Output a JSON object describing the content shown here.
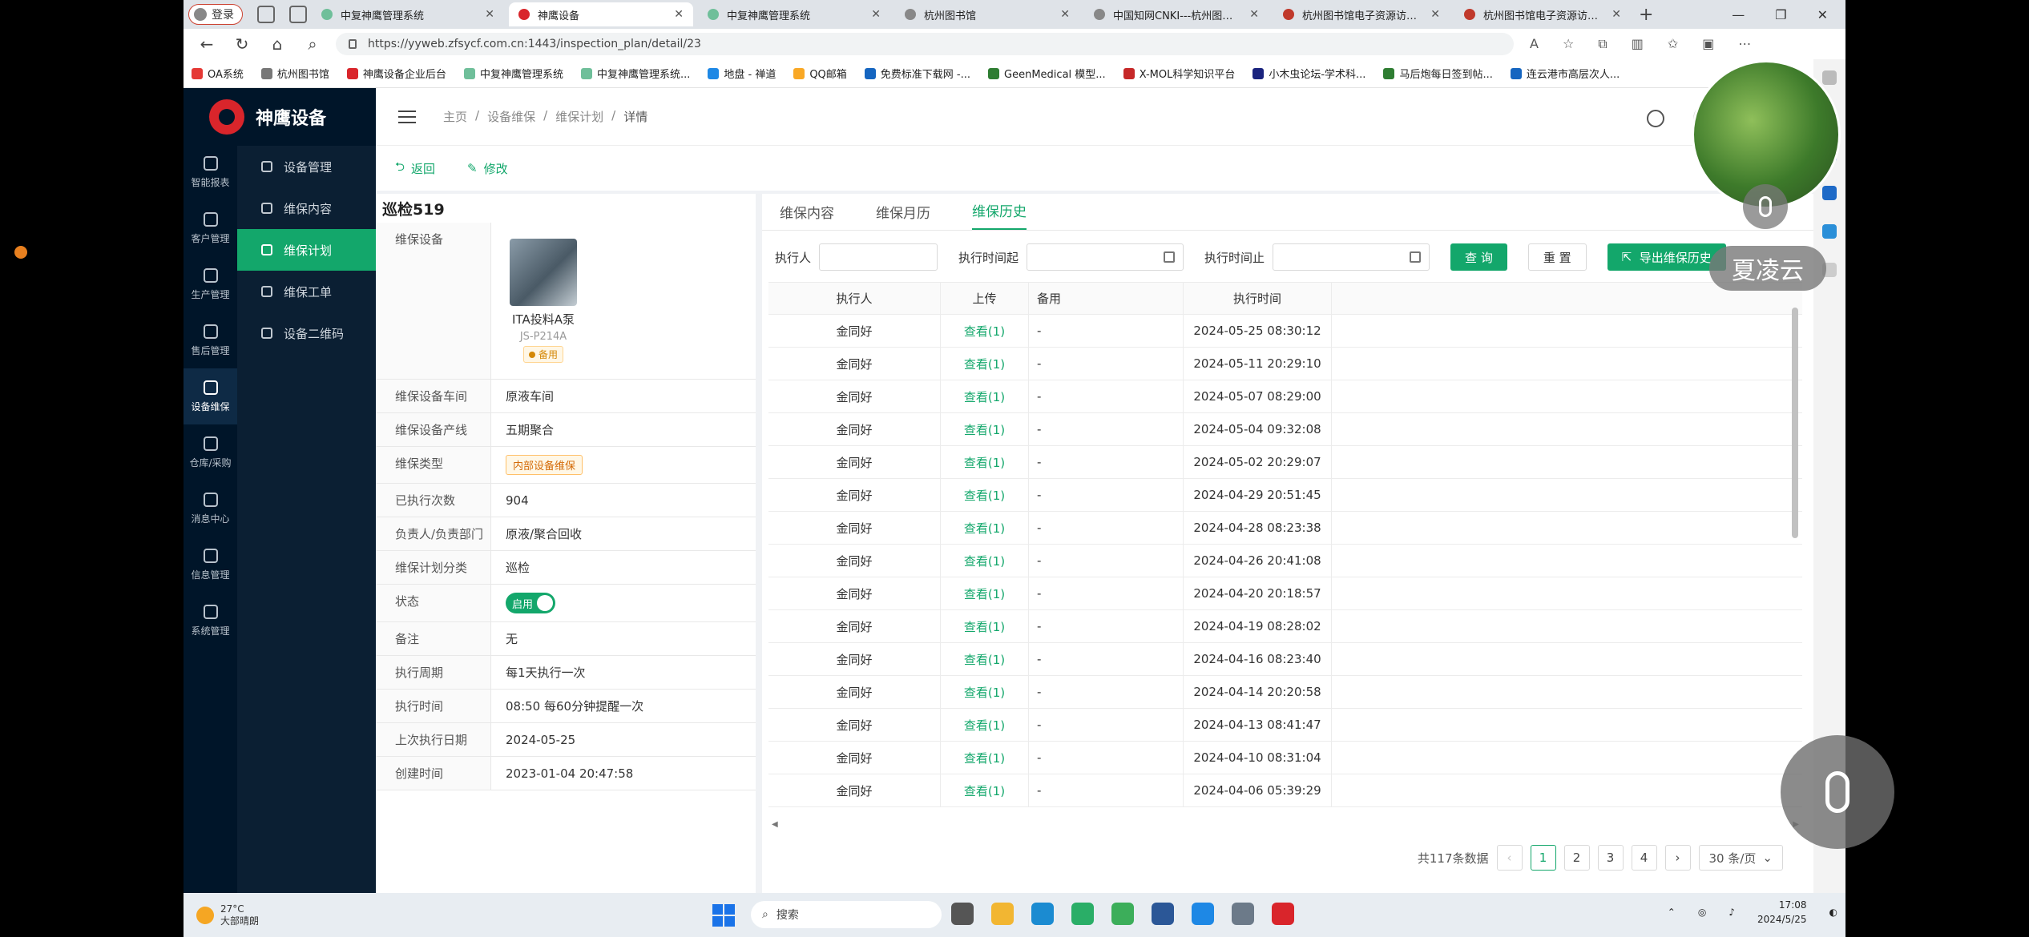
{
  "browser": {
    "login_label": "登录",
    "tabs": [
      {
        "title": "中复神鹰管理系统",
        "color": "#6fbf9a",
        "active": false
      },
      {
        "title": "神鹰设备",
        "color": "#d9252b",
        "active": true
      },
      {
        "title": "中复神鹰管理系统",
        "color": "#6fbf9a",
        "active": false
      },
      {
        "title": "杭州图书馆",
        "color": "#888888",
        "active": false
      },
      {
        "title": "中国知网CNKI---杭州图书馆",
        "color": "#888888",
        "active": false
      },
      {
        "title": "杭州图书馆电子资源访问系统",
        "color": "#c0392b",
        "active": false
      },
      {
        "title": "杭州图书馆电子资源访问系统",
        "color": "#c0392b",
        "active": false
      }
    ],
    "url": "https://yyweb.zfsycf.com.cn:1443/inspection_plan/detail/23",
    "bookmarks": [
      {
        "label": "OA系统",
        "color": "#e53935"
      },
      {
        "label": "杭州图书馆",
        "color": "#777777"
      },
      {
        "label": "神鹰设备企业后台",
        "color": "#d9252b"
      },
      {
        "label": "中复神鹰管理系统",
        "color": "#6fbf9a"
      },
      {
        "label": "中复神鹰管理系统...",
        "color": "#6fbf9a"
      },
      {
        "label": "地盘 - 禅道",
        "color": "#1e88e5"
      },
      {
        "label": "QQ邮箱",
        "color": "#f9a825"
      },
      {
        "label": "免费标准下载网 -...",
        "color": "#1565c0"
      },
      {
        "label": "GeenMedical 模型...",
        "color": "#2e7d32"
      },
      {
        "label": "X-MOL科学知识平台",
        "color": "#c62828"
      },
      {
        "label": "小木虫论坛-学术科...",
        "color": "#1a237e"
      },
      {
        "label": "马后炮每日签到帖...",
        "color": "#2e7d32"
      },
      {
        "label": "连云港市高层次人...",
        "color": "#1565c0"
      }
    ]
  },
  "app": {
    "name": "神鹰设备",
    "rail": [
      {
        "label": "智能报表",
        "active": false
      },
      {
        "label": "客户管理",
        "active": false
      },
      {
        "label": "生产管理",
        "active": false
      },
      {
        "label": "售后管理",
        "active": false
      },
      {
        "label": "设备维保",
        "active": true
      },
      {
        "label": "仓库/采购",
        "active": false
      },
      {
        "label": "消息中心",
        "active": false
      },
      {
        "label": "信息管理",
        "active": false
      },
      {
        "label": "系统管理",
        "active": false
      }
    ],
    "submenu": [
      {
        "label": "设备管理",
        "active": false
      },
      {
        "label": "维保内容",
        "active": false
      },
      {
        "label": "维保计划",
        "active": true
      },
      {
        "label": "维保工单",
        "active": false
      },
      {
        "label": "设备二维码",
        "active": false
      }
    ],
    "breadcrumb": [
      "主页",
      "/",
      "设备维保",
      "/",
      "维保计划",
      "/",
      "详情"
    ],
    "actions": {
      "back": "返回",
      "edit": "修改"
    }
  },
  "detail": {
    "title": "巡检519",
    "equipment_label": "维保设备",
    "equipment": {
      "name": "ITA投料A泵",
      "code": "JS-P214A",
      "tag": "备用"
    },
    "rows": [
      {
        "label": "维保设备车间",
        "value": "原液车间"
      },
      {
        "label": "维保设备产线",
        "value": "五期聚合"
      },
      {
        "label": "维保类型",
        "value": "内部设备维保",
        "style": "tag"
      },
      {
        "label": "已执行次数",
        "value": "904"
      },
      {
        "label": "负责人/负责部门",
        "value": "原液/聚合回收"
      },
      {
        "label": "维保计划分类",
        "value": "巡检"
      },
      {
        "label": "状态",
        "value": "启用",
        "style": "switch"
      },
      {
        "label": "备注",
        "value": "无"
      },
      {
        "label": "执行周期",
        "value": "每1天执行一次"
      },
      {
        "label": "执行时间",
        "value": "08:50 每60分钟提醒一次"
      },
      {
        "label": "上次执行日期",
        "value": "2024-05-25"
      },
      {
        "label": "创建时间",
        "value": "2023-01-04 20:47:58"
      }
    ]
  },
  "history": {
    "tabs": [
      {
        "label": "维保内容",
        "active": false
      },
      {
        "label": "维保月历",
        "active": false
      },
      {
        "label": "维保历史",
        "active": true
      }
    ],
    "filters": {
      "executor_label": "执行人",
      "start_label": "执行时间起",
      "end_label": "执行时间止",
      "query": "查 询",
      "reset": "重 置",
      "export": "导出维保历史"
    },
    "columns": [
      "执行人",
      "上传",
      "备用",
      "执行时间"
    ],
    "rows": [
      {
        "executor": "金同好",
        "upload": "查看(1)",
        "spare": "-",
        "time": "2024-05-25 08:30:12"
      },
      {
        "executor": "金同好",
        "upload": "查看(1)",
        "spare": "-",
        "time": "2024-05-11 20:29:10"
      },
      {
        "executor": "金同好",
        "upload": "查看(1)",
        "spare": "-",
        "time": "2024-05-07 08:29:00"
      },
      {
        "executor": "金同好",
        "upload": "查看(1)",
        "spare": "-",
        "time": "2024-05-04 09:32:08"
      },
      {
        "executor": "金同好",
        "upload": "查看(1)",
        "spare": "-",
        "time": "2024-05-02 20:29:07"
      },
      {
        "executor": "金同好",
        "upload": "查看(1)",
        "spare": "-",
        "time": "2024-04-29 20:51:45"
      },
      {
        "executor": "金同好",
        "upload": "查看(1)",
        "spare": "-",
        "time": "2024-04-28 08:23:38"
      },
      {
        "executor": "金同好",
        "upload": "查看(1)",
        "spare": "-",
        "time": "2024-04-26 20:41:08"
      },
      {
        "executor": "金同好",
        "upload": "查看(1)",
        "spare": "-",
        "time": "2024-04-20 20:18:57"
      },
      {
        "executor": "金同好",
        "upload": "查看(1)",
        "spare": "-",
        "time": "2024-04-19 08:28:02"
      },
      {
        "executor": "金同好",
        "upload": "查看(1)",
        "spare": "-",
        "time": "2024-04-16 08:23:40"
      },
      {
        "executor": "金同好",
        "upload": "查看(1)",
        "spare": "-",
        "time": "2024-04-14 20:20:58"
      },
      {
        "executor": "金同好",
        "upload": "查看(1)",
        "spare": "-",
        "time": "2024-04-13 08:41:47"
      },
      {
        "executor": "金同好",
        "upload": "查看(1)",
        "spare": "-",
        "time": "2024-04-10 08:31:04"
      },
      {
        "executor": "金同好",
        "upload": "查看(1)",
        "spare": "-",
        "time": "2024-04-06 05:39:29"
      }
    ],
    "pagination": {
      "total": "共117条数据",
      "pages": [
        "1",
        "2",
        "3",
        "4"
      ],
      "current": "1",
      "page_size": "30 条/页"
    }
  },
  "overlay": {
    "speaker_name": "夏凌云"
  },
  "taskbar": {
    "weather_temp": "27°C",
    "weather_desc": "大部晴朗",
    "search": "搜索",
    "time": "17:08",
    "date": "2024/5/25"
  },
  "colors": {
    "accent": "#13a76b",
    "sidebar": "#001529",
    "brand": "#d9252b"
  }
}
